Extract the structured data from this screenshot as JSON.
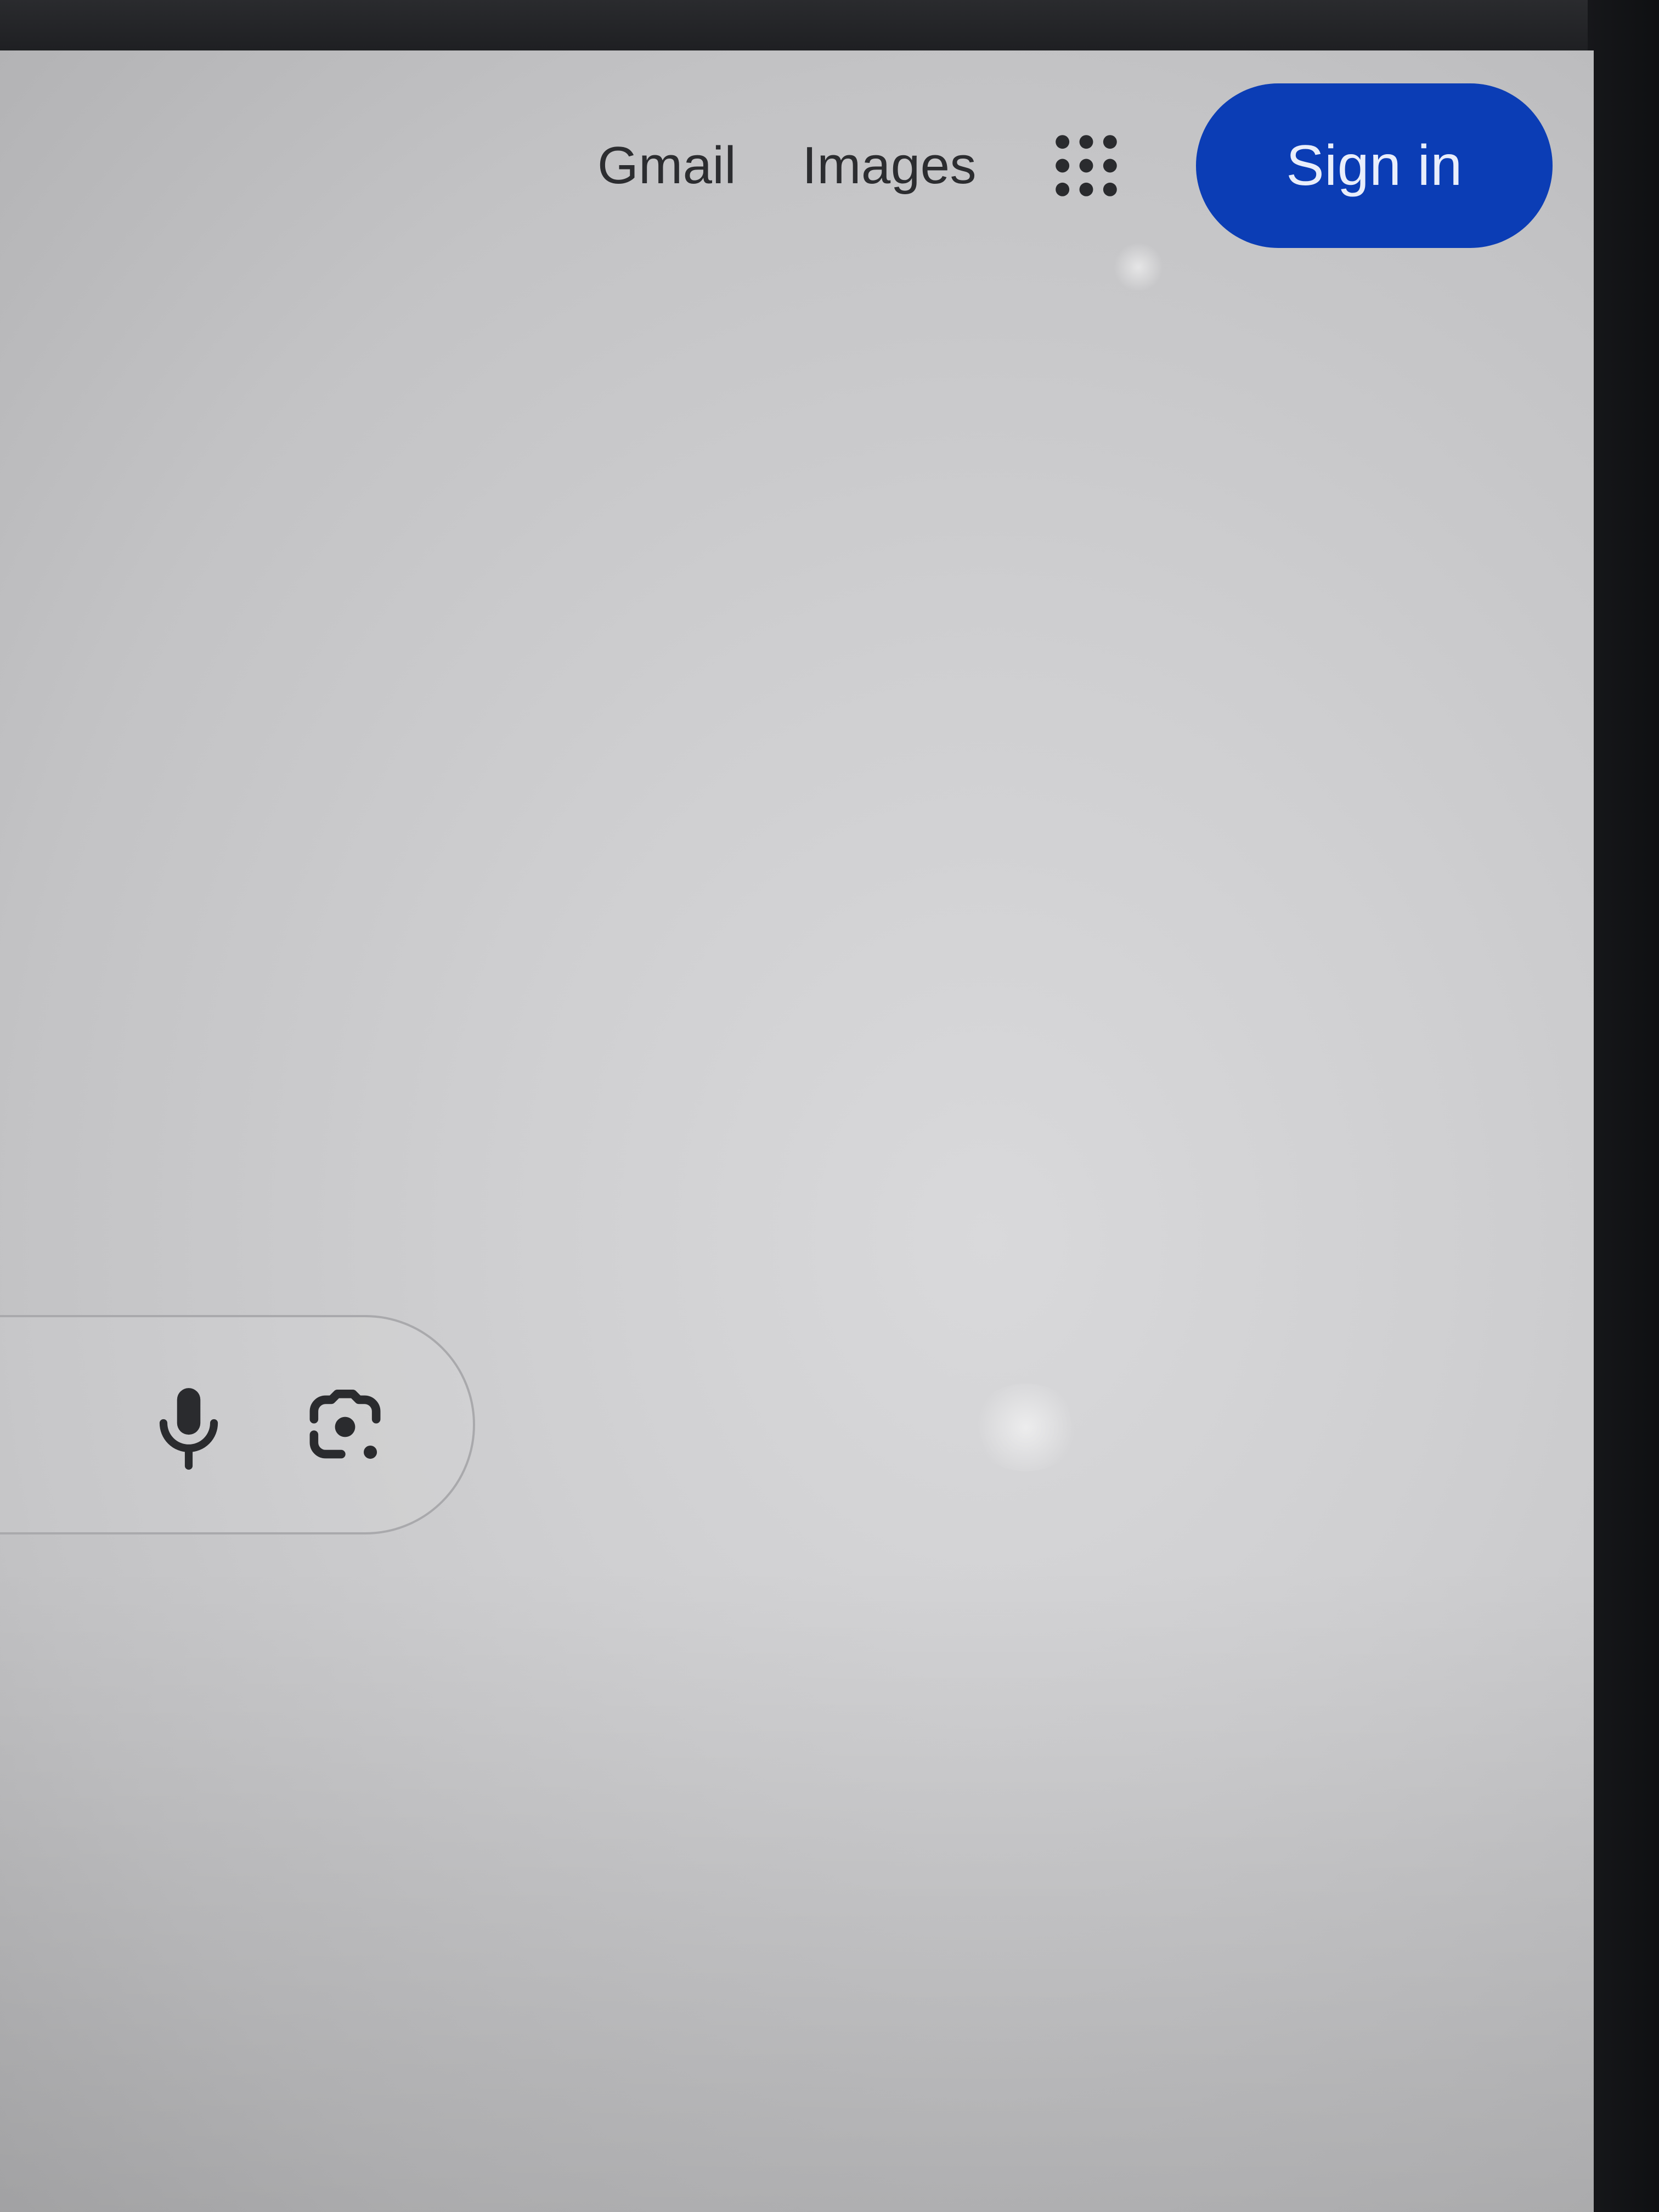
{
  "header": {
    "links": [
      "Gmail",
      "Images"
    ],
    "apps_icon": "apps-grid-icon",
    "signin_label": "Sign in"
  },
  "search": {
    "placeholder": "",
    "value": "",
    "voice_icon": "microphone-icon",
    "lens_icon": "camera-lens-icon"
  },
  "colors": {
    "signin_bg": "#0b3db5",
    "signin_text": "#e9eefb",
    "page_bg": "#d4d4d6",
    "bezel": "#1b1c1e"
  }
}
